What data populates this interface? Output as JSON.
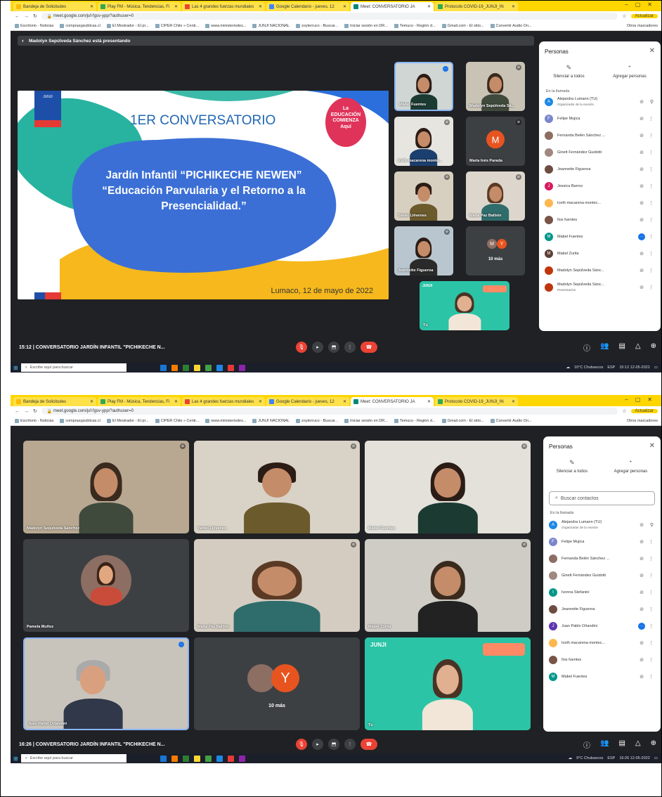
{
  "browser": {
    "tabs": [
      {
        "title": "Bandeja de Solicitudes",
        "color": "#fbbc04"
      },
      {
        "title": "Play FM - Música, Tendencias, Fi",
        "color": "#34a853"
      },
      {
        "title": "Las 4 grandes fuerzas mundiales",
        "color": "#ea4335"
      },
      {
        "title": "Google Calendario - jueves, 12",
        "color": "#4285f4"
      },
      {
        "title": "Meet: CONVERSATORIO JA",
        "color": "#00897b"
      },
      {
        "title": "Protocolo COVID-19_JUNJI_IN",
        "color": "#34a853"
      }
    ],
    "url": "meet.google.com/juf-fgsv-ypp/?authuser=0",
    "update_label": "Actualizar",
    "bookmarks": [
      "Escritorio - Noticias",
      "comprasypublicas.cl",
      "El Mostrador - El pr...",
      "CIPER Chile » Centr...",
      "www.ministeriodes...",
      "JUNJI NACIONAL",
      "zoyterruco - Buscar...",
      "Iniciar sesión en DR...",
      "Temuco - Región d...",
      "Gmail.com - El sitio...",
      "Convertir Audio On..."
    ],
    "other_bookmarks": "Otros marcadores"
  },
  "shot1": {
    "presenting_banner": "Madolyn Sepúlveda Sánchez está presentando",
    "slide": {
      "heading": "1ER CONVERSATORIO",
      "line1": "Jardín Infantil “PICHIKECHE NEWEN”",
      "line2": "“Educación Parvularia y el Retorno a la",
      "line3": "Presencialidad.”",
      "date": "Lumaco, 12 de mayo de 2022",
      "badge": [
        "La",
        "EDUCACIÓN",
        "COMIENZA",
        "Aquí"
      ],
      "ministry": "JUNJI"
    },
    "tiles": [
      {
        "name": "Mabel Fuentes",
        "selected": true
      },
      {
        "name": "Madolyn Sepúlveda Sá...",
        "selected": false
      },
      {
        "name": "Iceth macarena monte...",
        "selected": false
      },
      {
        "name": "María Inés Parada",
        "avatar_letter": "M",
        "avatar_color": "#e8541f"
      },
      {
        "name": "Yaniel Llévenes",
        "selected": false
      },
      {
        "name": "María Paz Balbón",
        "selected": false
      },
      {
        "name": "Jeannette Figueroa",
        "selected": false
      },
      {
        "name": "10 más",
        "letters": [
          "M",
          "Y"
        ]
      },
      {
        "name": "Tú",
        "self": true
      }
    ],
    "meeting_label": "15:12 | CONVERSATORIO JARDÍN INFANTIL \"PICHIKECHE N...",
    "panel": {
      "title": "Personas",
      "mute_all": "Silenciar a todos",
      "add_people": "Agregar personas",
      "section": "En la llamada",
      "people": [
        {
          "name": "Alejandra Lumann (TÚ)",
          "sub": "Organizador de la reunión",
          "letter": "A",
          "color": "#1e88e5"
        },
        {
          "name": "Felipe Mujica",
          "letter": "F",
          "color": "#7986cb"
        },
        {
          "name": "Fernanda Belén Sánchez ...",
          "letter": "",
          "color": "#8d6e63"
        },
        {
          "name": "Ginett Fernández Guidotti",
          "letter": "",
          "color": "#a1887f"
        },
        {
          "name": "Jeannette Figueroa",
          "letter": "",
          "color": "#6d4c41"
        },
        {
          "name": "Jessica Barros",
          "letter": "J",
          "color": "#d81b60"
        },
        {
          "name": "Iceth macarena montec...",
          "letter": "",
          "color": "#ffb74d"
        },
        {
          "name": "Ilos fuentes",
          "letter": "",
          "color": "#795548"
        },
        {
          "name": "Mabel Fuentes",
          "letter": "M",
          "color": "#009688"
        },
        {
          "name": "Mabel Zurita",
          "letter": "M",
          "color": "#5d4037"
        },
        {
          "name": "Madolyn Sepúlveda Sánc...",
          "letter": "",
          "color": "#bf360c"
        },
        {
          "name": "Madolyn Sepúlveda Sánc...",
          "sub": "Presentación",
          "letter": "",
          "color": "#bf360c"
        }
      ]
    },
    "taskbar": {
      "search": "Escribe aquí para buscar",
      "weather": "10°C Chubascos",
      "lang": "ESP",
      "time": "15:12",
      "date": "12-05-2022"
    }
  },
  "shot2": {
    "tiles": [
      {
        "name": "Madolyn Sepúlveda Sánchez"
      },
      {
        "name": "Yaniel Llévenes"
      },
      {
        "name": "Mabel Fuentes"
      },
      {
        "name": "Pamela Muñoz"
      },
      {
        "name": "María Paz Balbón"
      },
      {
        "name": "Mabel Zurita"
      },
      {
        "name": "Juan Pablo Orlandini"
      },
      {
        "name": "10 más",
        "letter": "Y"
      },
      {
        "name": "Tú"
      }
    ],
    "meeting_label": "16:26 | CONVERSATORIO JARDÍN INFANTIL \"PICHIKECHE N...",
    "panel": {
      "title": "Personas",
      "mute_all": "Silenciar a todos",
      "add_people": "Agregar personas",
      "search_placeholder": "Buscar contactos",
      "section": "En la llamada",
      "people": [
        {
          "name": "Alejandra Lumann (TÚ)",
          "sub": "Organizador de la reunión",
          "letter": "A",
          "color": "#1e88e5"
        },
        {
          "name": "Felipe Mujica",
          "letter": "F",
          "color": "#7986cb"
        },
        {
          "name": "Fernanda Belén Sánchez ...",
          "letter": "",
          "color": "#8d6e63"
        },
        {
          "name": "Ginett Fernández Guidotti",
          "letter": "",
          "color": "#a1887f"
        },
        {
          "name": "Ivonna Stefanini",
          "letter": "I",
          "color": "#009688"
        },
        {
          "name": "Jeannette Figueroa",
          "letter": "",
          "color": "#6d4c41"
        },
        {
          "name": "Juan Pablo Orlandini",
          "letter": "J",
          "color": "#5e35b1"
        },
        {
          "name": "Iceth macarena montec...",
          "letter": "",
          "color": "#ffb74d"
        },
        {
          "name": "Ilos fuentes",
          "letter": "",
          "color": "#795548"
        },
        {
          "name": "Mabel Fuentes",
          "letter": "M",
          "color": "#009688"
        }
      ]
    },
    "taskbar": {
      "search": "Escribe aquí para buscar",
      "weather": "9°C Chubascos",
      "lang": "ESP",
      "time": "16:26",
      "date": "12-05-2022"
    }
  }
}
